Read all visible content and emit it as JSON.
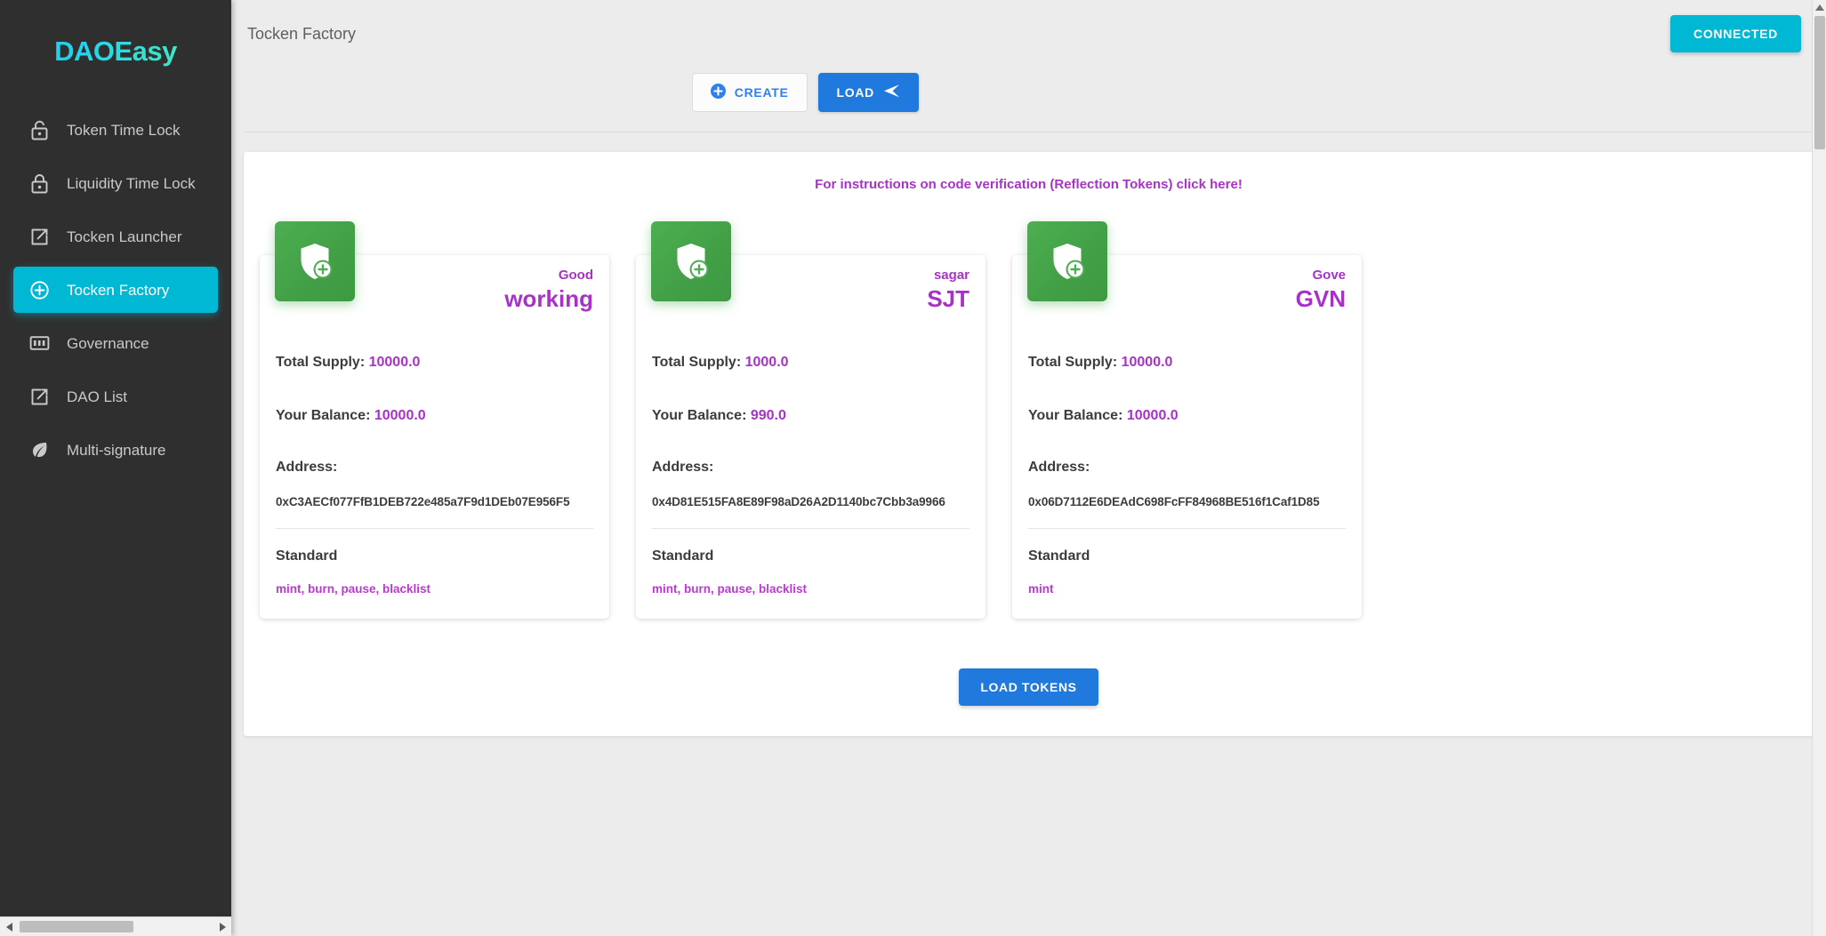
{
  "sidebar": {
    "logo": "DAOEasy",
    "items": [
      {
        "label": "Token Time Lock",
        "icon": "unlock-icon",
        "active": false
      },
      {
        "label": "Liquidity Time Lock",
        "icon": "lock-icon",
        "active": false
      },
      {
        "label": "Tocken Launcher",
        "icon": "external-link-icon",
        "active": false
      },
      {
        "label": "Tocken Factory",
        "icon": "plus-circle-icon",
        "active": true
      },
      {
        "label": "Governance",
        "icon": "calculator-icon",
        "active": false
      },
      {
        "label": "DAO List",
        "icon": "external-link-icon",
        "active": false
      },
      {
        "label": "Multi-signature",
        "icon": "leaf-icon",
        "active": false
      }
    ]
  },
  "header": {
    "title": "Tocken Factory",
    "wallet_status": "CONNECTED"
  },
  "toolbar": {
    "create_label": "CREATE",
    "load_label": "LOAD"
  },
  "panel": {
    "banner": "For instructions on code verification (Reflection Tokens) click here!",
    "load_tokens_label": "LOAD TOKENS",
    "labels": {
      "total_supply": "Total Supply:",
      "your_balance": "Your Balance:",
      "address": "Address:",
      "standard": "Standard"
    }
  },
  "tokens": [
    {
      "name": "Good",
      "symbol": "working",
      "total_supply": "10000.0",
      "balance": "10000.0",
      "address": "0xC3AECf077FfB1DEB722e485a7F9d1DEb07E956F5",
      "standard": "mint, burn, pause, blacklist"
    },
    {
      "name": "sagar",
      "symbol": "SJT",
      "total_supply": "1000.0",
      "balance": "990.0",
      "address": "0x4D81E515FA8E89F98aD26A2D1140bc7Cbb3a9966",
      "standard": "mint, burn, pause, blacklist"
    },
    {
      "name": "Gove",
      "symbol": "GVN",
      "total_supply": "10000.0",
      "balance": "10000.0",
      "address": "0x06D7112E6DEAdC698FcFF84968BE516f1Caf1D85",
      "standard": "mint"
    }
  ],
  "colors": {
    "accent_cyan": "#00b8d4",
    "accent_blue": "#2079dd",
    "accent_purple": "#a832c8",
    "badge_green": "#4caf50",
    "sidebar_bg": "#2f2f2f",
    "page_bg": "#ececec"
  }
}
